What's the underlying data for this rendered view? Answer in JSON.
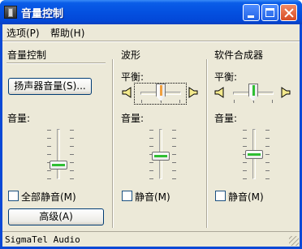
{
  "window": {
    "title": "音量控制"
  },
  "menu": {
    "options": "选项(P)",
    "help": "帮助(H)"
  },
  "master": {
    "title": "音量控制",
    "speaker_button": "扬声器音量(S)...",
    "volume_label": "音量:",
    "mute_label": "全部静音(M)",
    "mute_checked": false,
    "advanced_button": "高级(A)"
  },
  "wave": {
    "title": "波形",
    "balance_label": "平衡:",
    "volume_label": "音量:",
    "mute_label": "静音(M)",
    "mute_checked": false
  },
  "synth": {
    "title": "软件合成器",
    "balance_label": "平衡:",
    "volume_label": "音量:",
    "mute_label": "静音(M)",
    "mute_checked": false
  },
  "status": {
    "device": "SigmaTel Audio"
  },
  "icons": [
    "app-icon",
    "minimize-icon",
    "maximize-icon",
    "close-icon",
    "speaker-left-icon",
    "speaker-right-icon"
  ]
}
